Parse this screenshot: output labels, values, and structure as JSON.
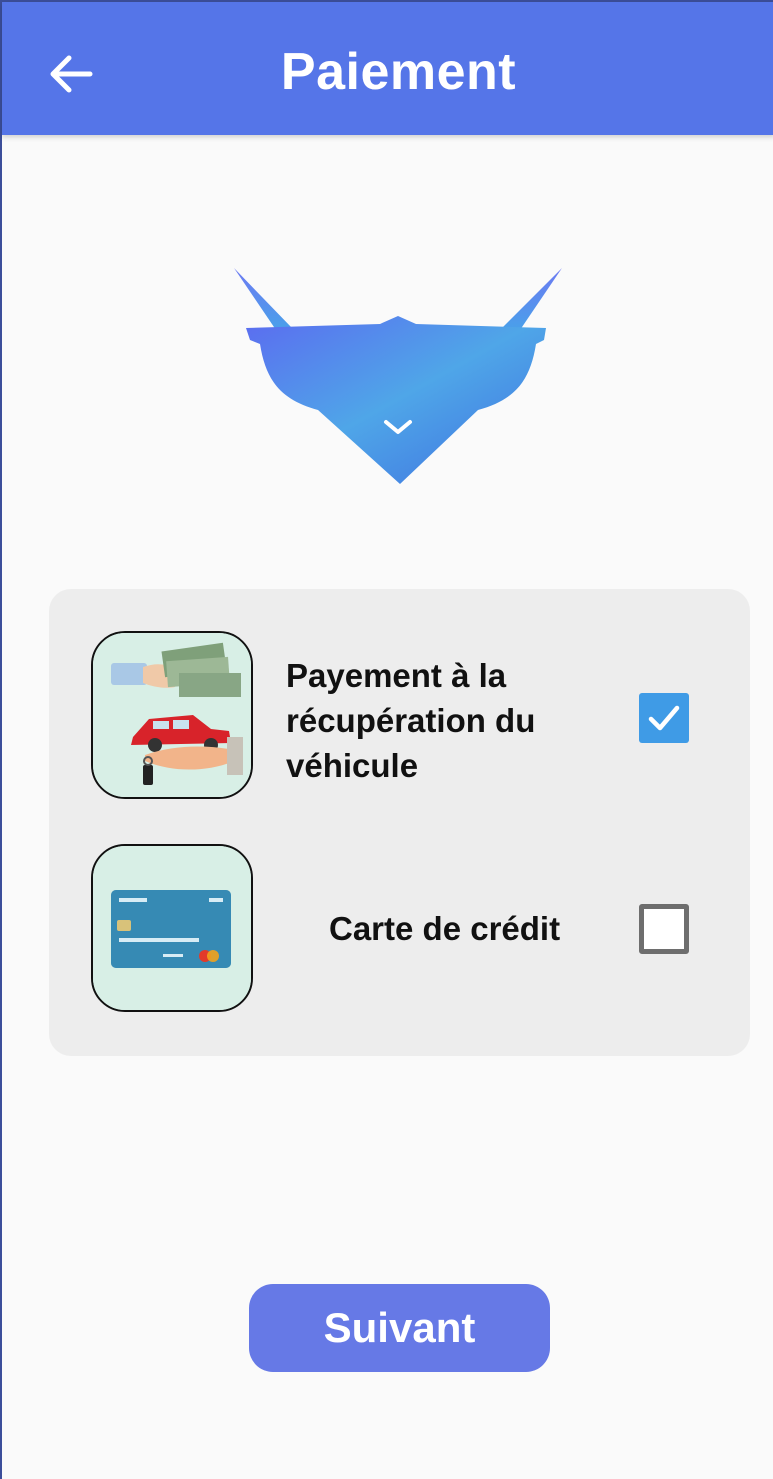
{
  "appbar": {
    "title": "Paiement",
    "back_icon": "arrow-left-icon"
  },
  "logo": {
    "icon": "app-logo"
  },
  "payment_options": [
    {
      "label": "Payement à la récupération du véhicule",
      "checked": true,
      "image": "cash-and-car-illustration"
    },
    {
      "label": "Carte de crédit",
      "checked": false,
      "image": "credit-card-illustration"
    }
  ],
  "next_button": {
    "label": "Suivant"
  },
  "colors": {
    "primary": "#5575E8",
    "button": "#6679E6",
    "checkbox_checked": "#3F9BE6",
    "card_bg": "#EDEDED"
  }
}
